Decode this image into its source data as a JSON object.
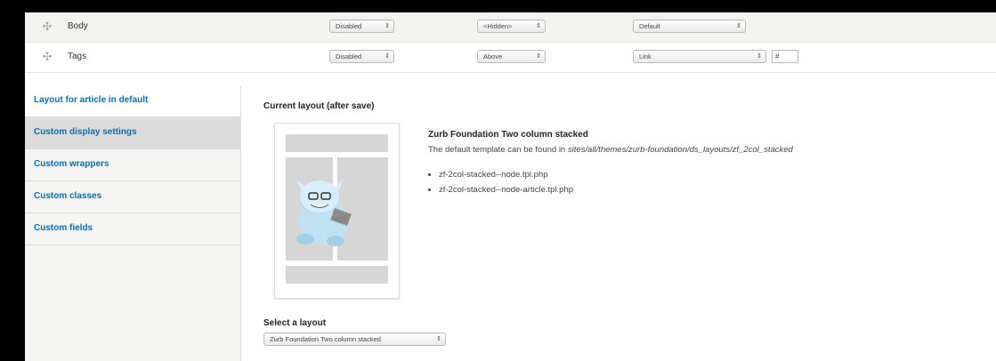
{
  "fields": [
    {
      "name": "Body",
      "label_select": "Disabled",
      "format_select": "<Hidden>",
      "formatter_select": "Default",
      "extra_input": ""
    },
    {
      "name": "Tags",
      "label_select": "Disabled",
      "format_select": "Above",
      "formatter_select": "Link",
      "extra_input": "#"
    }
  ],
  "tabs": [
    {
      "label": "Layout for article in default"
    },
    {
      "label": "Custom display settings"
    },
    {
      "label": "Custom wrappers"
    },
    {
      "label": "Custom classes"
    },
    {
      "label": "Custom fields"
    }
  ],
  "main": {
    "heading": "Current layout (after save)",
    "layout_title": "Zurb Foundation Two column stacked",
    "layout_desc_prefix": "The default template can be found in ",
    "layout_desc_path": "sites/all/themes/zurb-foundation/ds_layouts/zf_2col_stacked",
    "templates": [
      "zf-2col-stacked--node.tpl.php",
      "zf-2col-stacked--node-article.tpl.php"
    ],
    "select_label": "Select a layout",
    "select_value": "Zurb Foundation Two column stacked",
    "select_arrow": "⇕"
  },
  "icons": {
    "drag": "✣",
    "select_arrow": "⇕",
    "mascot": "yeti-mascot-icon"
  },
  "colors": {
    "tab_link": "#0a6fa8",
    "row_bg": "#f2f2ef",
    "tab_bg": "#f4f4f2"
  }
}
